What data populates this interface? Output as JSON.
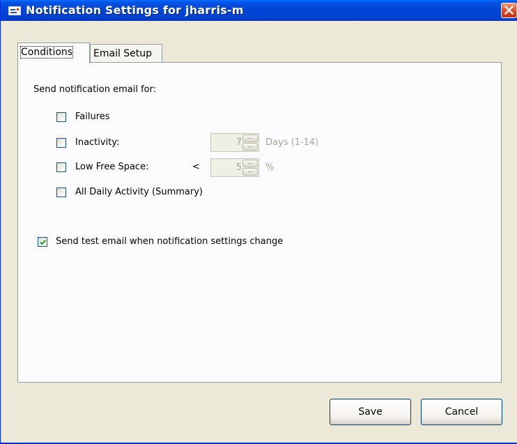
{
  "window": {
    "title": "Notification Settings for jharris-m"
  },
  "tabs": [
    {
      "label": "Conditions",
      "active": true
    },
    {
      "label": "Email Setup",
      "active": false
    }
  ],
  "conditions": {
    "section_label": "Send notification email for:",
    "options": [
      {
        "label": "Failures",
        "checked": false
      },
      {
        "label": "Inactivity:",
        "checked": false
      },
      {
        "label": "Low Free Space:",
        "checked": false
      },
      {
        "label": "All Daily Activity (Summary)",
        "checked": false
      }
    ],
    "inactivity": {
      "value": "7",
      "unit": "Days (1-14)"
    },
    "low_free_space": {
      "comparator": "<",
      "value": "5",
      "unit": "%"
    },
    "test_email": {
      "label": "Send test email when notification settings change",
      "checked": true
    }
  },
  "footer": {
    "save_label": "Save",
    "cancel_label": "Cancel"
  },
  "colors": {
    "titlebar": "#0553e4",
    "close": "#e2512a",
    "dialog_bg": "#ece9d8",
    "panel_bg": "#fcfcfe"
  },
  "icons": {
    "title": "notification-window-icon",
    "close": "close-icon",
    "check": "checkmark-icon"
  }
}
